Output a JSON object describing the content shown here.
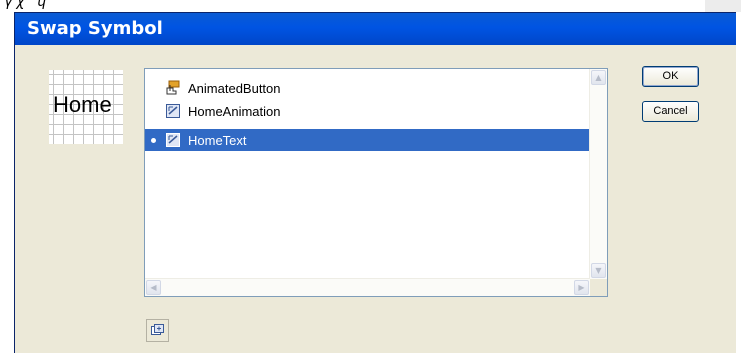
{
  "window": {
    "title": "Swap Symbol"
  },
  "top_fragment": "γχ ɥ",
  "preview": {
    "text": "Home"
  },
  "symbols": [
    {
      "name": "AnimatedButton",
      "type": "button",
      "selected": false
    },
    {
      "name": "HomeAnimation",
      "type": "movie-clip",
      "selected": false
    },
    {
      "name": "HomeText",
      "type": "movie-clip",
      "selected": true
    }
  ],
  "buttons": {
    "ok": "OK",
    "cancel": "Cancel"
  },
  "scrollbars": {
    "up": "▲",
    "down": "▼",
    "left": "◀",
    "right": "▶"
  },
  "colors": {
    "title_bar": "#0054e3",
    "selection": "#316ac5",
    "dialog_bg": "#ece9d8"
  }
}
